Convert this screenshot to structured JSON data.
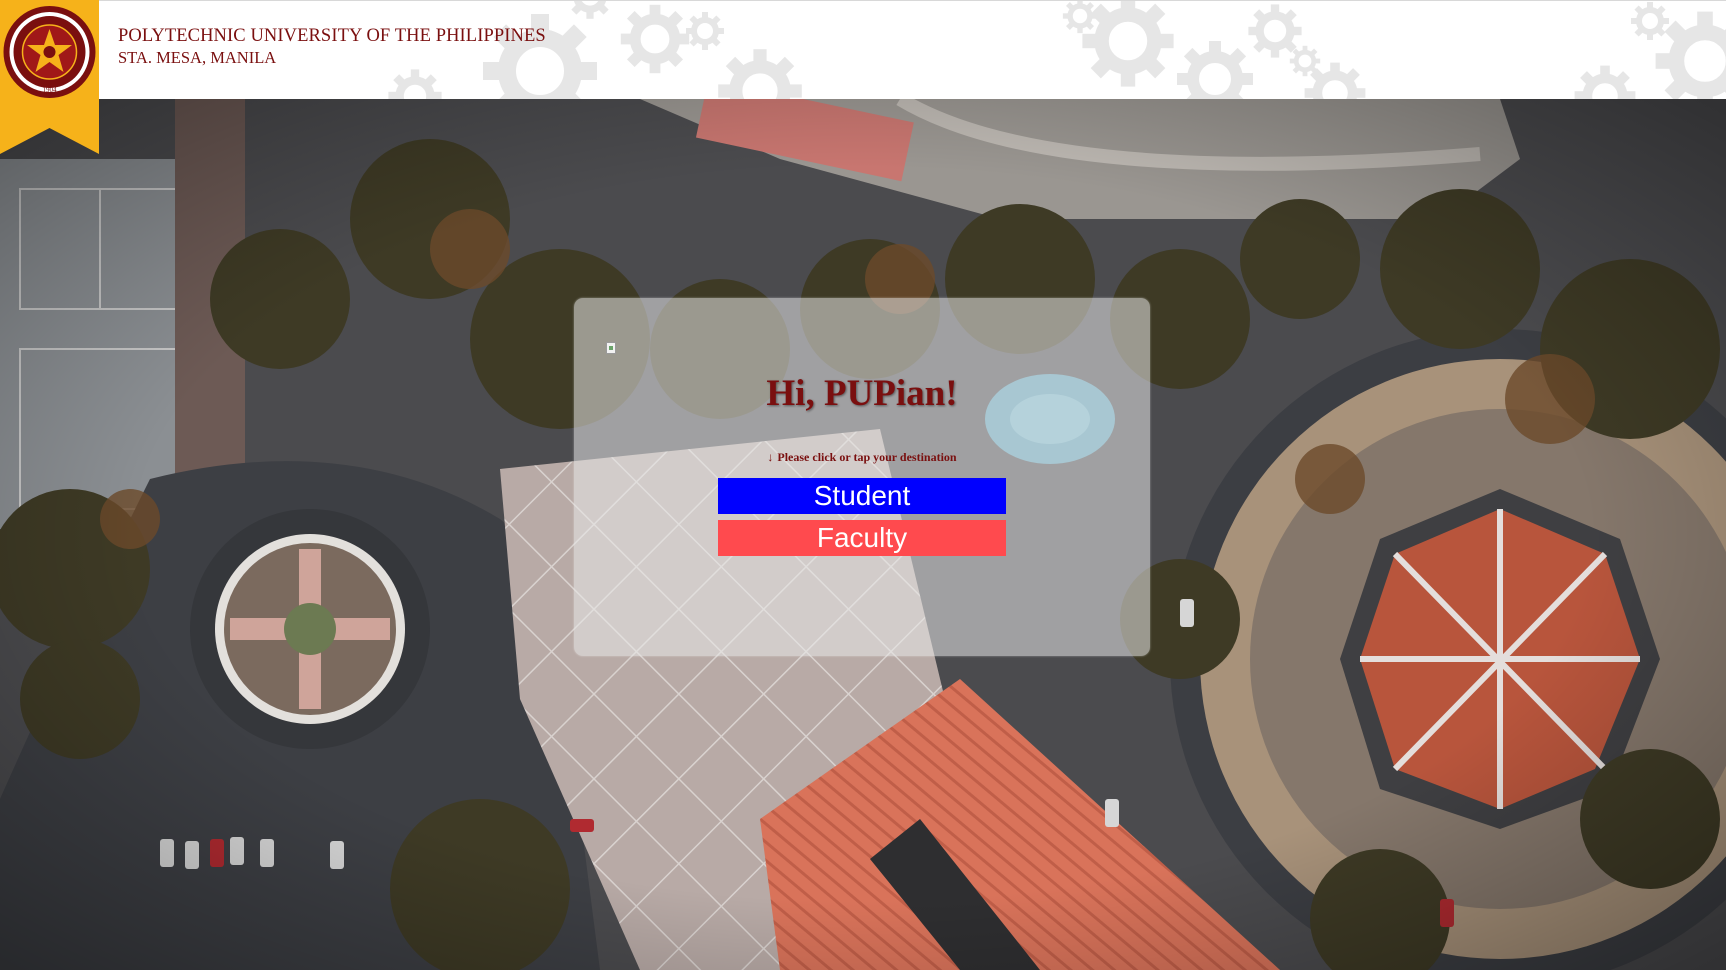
{
  "header": {
    "university_name": "POLYTECHNIC UNIVERSITY OF THE PHILIPPINES",
    "location": "STA. MESA, MANILA",
    "seal_text": "POLYTECHNIC UNIVERSITY OF THE PHILIPPINES",
    "seal_year": "1904"
  },
  "card": {
    "greeting": "Hi, PUPian!",
    "instruction_arrow": "↓",
    "instruction": "Please click or tap your destination",
    "buttons": {
      "student": "Student",
      "faculty": "Faculty"
    }
  },
  "colors": {
    "maroon": "#7a0f0f",
    "ribbon_gold": "#f6b21a",
    "student_button": "#0000ff",
    "faculty_button": "#ff4a4e"
  },
  "icons": {
    "seal": "university-seal-icon",
    "broken_image": "broken-image-icon",
    "gear_pattern": "gear-pattern"
  }
}
